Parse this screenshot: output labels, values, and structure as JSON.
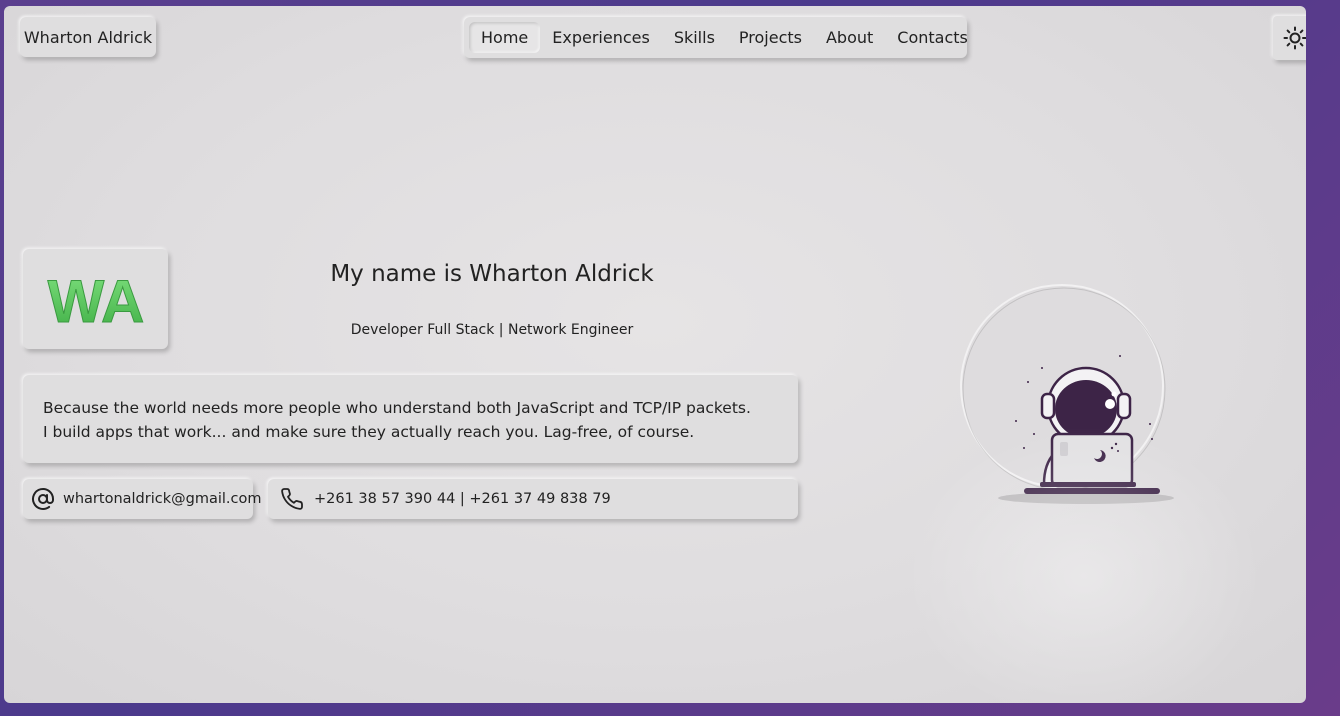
{
  "header": {
    "brand": "Wharton Aldrick",
    "nav": [
      "Home",
      "Experiences",
      "Skills",
      "Projects",
      "About",
      "Contacts"
    ],
    "active_nav": "Home",
    "theme_icon": "sun-icon"
  },
  "hero": {
    "monogram": "WA",
    "title": "My name is Wharton Aldrick",
    "subtitle": "Developer Full Stack | Network Engineer",
    "bio_line1": "Because the world needs more people who understand both JavaScript and TCP/IP packets.",
    "bio_line2": "I build apps that work... and make sure they actually reach you. Lag-free, of course."
  },
  "contacts": {
    "email": "whartonaldrick@gmail.com",
    "email_icon": "at-sign-icon",
    "phone": "+261 38 57 390 44 | +261 37 49 838 79",
    "phone_icon": "phone-icon"
  },
  "illustration": {
    "icon": "astronaut-laptop-illustration"
  },
  "colors": {
    "accent_green": "#5cc95e",
    "astronaut_purple": "#3d2447",
    "frame_border": "#553f8e"
  }
}
